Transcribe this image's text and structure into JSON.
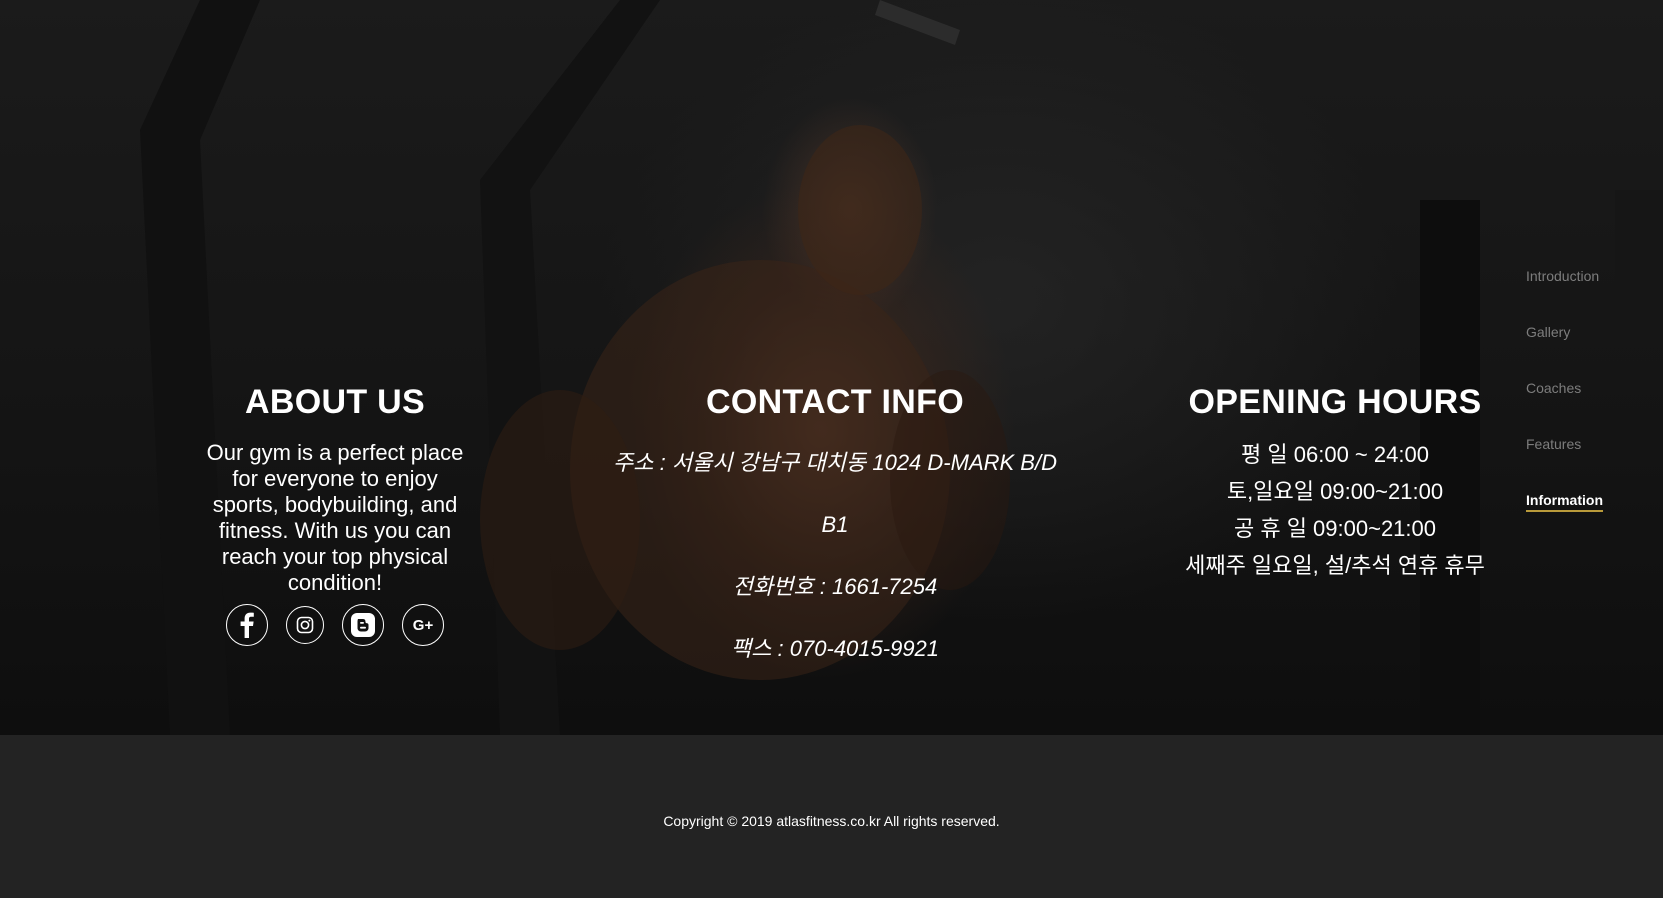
{
  "about": {
    "title": "ABOUT US",
    "text": "Our gym is a perfect place for everyone to enjoy sports, bodybuilding, and fitness. With us you can reach your top physical condition!",
    "social": [
      {
        "name": "facebook-icon"
      },
      {
        "name": "instagram-icon"
      },
      {
        "name": "blogger-icon"
      },
      {
        "name": "google-plus-icon",
        "glyph": "G+"
      }
    ]
  },
  "contact": {
    "title": "CONTACT INFO",
    "address_line1": "주소 : 서울시 강남구 대치동 1024 D-MARK B/D",
    "address_line2": "B1",
    "phone": "전화번호 : 1661-7254",
    "fax": "팩스 : 070-4015-9921"
  },
  "hours": {
    "title": "OPENING HOURS",
    "lines": [
      "평 일 06:00 ~ 24:00",
      "토,일요일 09:00~21:00",
      "공 휴 일 09:00~21:00",
      "세째주 일요일, 설/추석 연휴 휴무"
    ]
  },
  "side_nav": {
    "items": [
      {
        "label": "Introduction"
      },
      {
        "label": "Gallery"
      },
      {
        "label": "Coaches"
      },
      {
        "label": "Features"
      },
      {
        "label": "Information"
      }
    ],
    "active_index": 4
  },
  "footer": {
    "copyright": "Copyright © 2019 atlasfitness.co.kr All rights reserved."
  },
  "colors": {
    "footer_bg": "#232323",
    "nav_inactive": "#7d7d7d",
    "nav_active_underline": "#b99a3a"
  }
}
